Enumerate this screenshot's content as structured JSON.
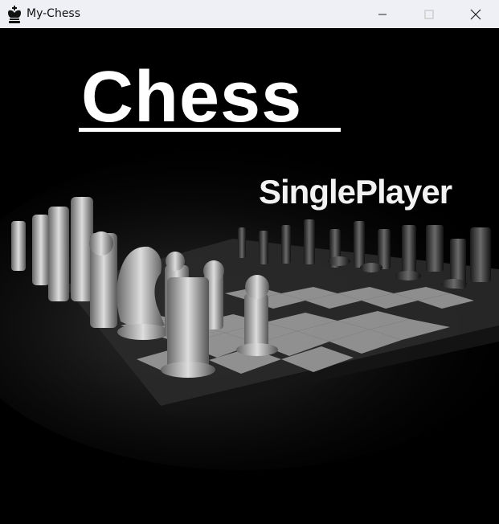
{
  "window": {
    "title": "My-Chess",
    "icon": "chess-king-icon"
  },
  "controls": {
    "minimize": "minimize-icon",
    "maximize": "maximize-icon",
    "close": "close-icon"
  },
  "main": {
    "heading": "Chess",
    "single_player_label": "SinglePlayer"
  },
  "colors": {
    "titlebar_bg": "#eef0f6",
    "content_bg": "#000000",
    "text": "#ffffff"
  }
}
